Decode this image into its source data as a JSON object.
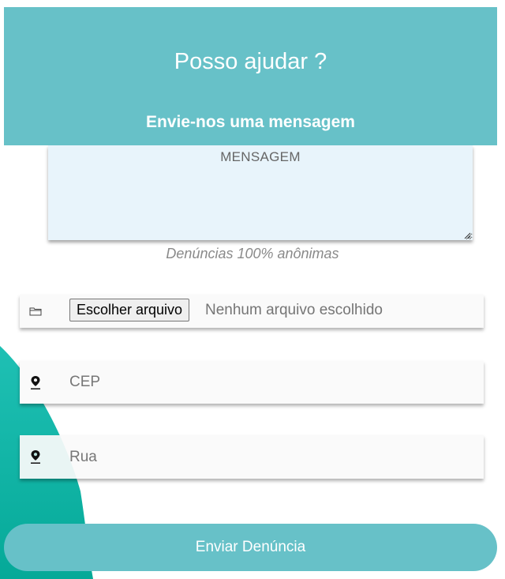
{
  "header": {
    "title": "Posso ajudar ?",
    "subtitle": "Envie-nos uma mensagem"
  },
  "message": {
    "placeholder": "MENSAGEM",
    "note": "Denúncias 100% anônimas"
  },
  "file": {
    "button_label": "Escolher arquivo",
    "status": "Nenhum arquivo escolhido",
    "icon": "folder-icon"
  },
  "cep": {
    "placeholder": "CEP",
    "icon": "map-pin-icon"
  },
  "rua": {
    "placeholder": "Rua",
    "icon": "map-pin-icon"
  },
  "submit_label": "Enviar Denúncia",
  "colors": {
    "header": "#67c1c8",
    "message_bg": "#e8f4fb",
    "wave": "#13b8aa",
    "field_bg": "#fafafa"
  }
}
